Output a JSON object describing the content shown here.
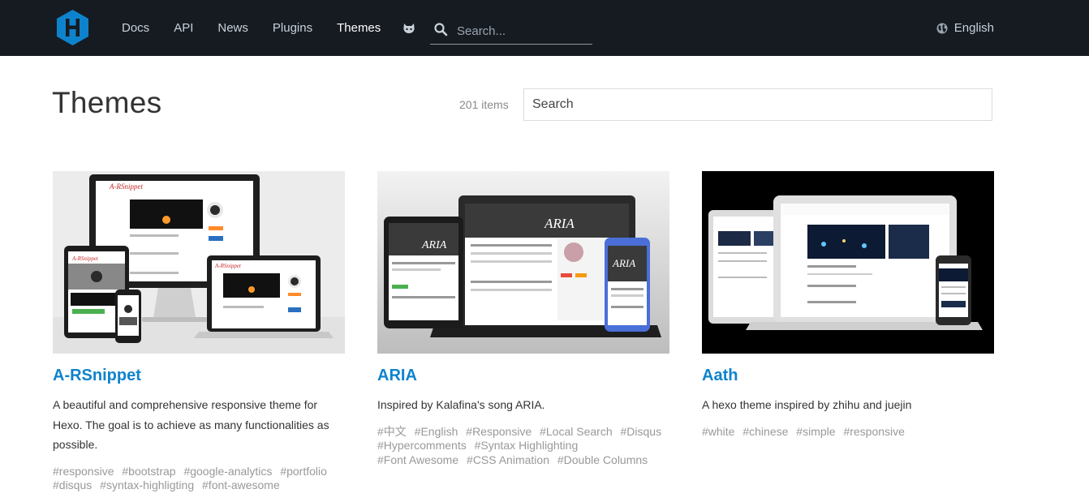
{
  "nav": {
    "items": [
      "Docs",
      "API",
      "News",
      "Plugins",
      "Themes"
    ],
    "search_placeholder": "Search...",
    "language": "English"
  },
  "page": {
    "title": "Themes",
    "count": "201 items",
    "search_placeholder": "Search"
  },
  "themes": [
    {
      "name": "A-RSnippet",
      "description": "A beautiful and comprehensive responsive theme for Hexo. The goal is to achieve as many functionalities as possible.",
      "tags": [
        "#responsive",
        "#bootstrap",
        "#google-analytics",
        "#portfolio",
        "#disqus",
        "#syntax-highligting",
        "#font-awesome"
      ],
      "screen_title": "A-RSnippet"
    },
    {
      "name": "ARIA",
      "description": "Inspired by Kalafina's song ARIA.",
      "tags": [
        "#中文",
        "#English",
        "#Responsive",
        "#Local Search",
        "#Disqus",
        "#Hypercomments",
        "#Syntax Highlighting",
        "#Font Awesome",
        "#CSS Animation",
        "#Double Columns"
      ],
      "screen_title": "ARIA"
    },
    {
      "name": "Aath",
      "description": "A hexo theme inspired by zhihu and juejin",
      "tags": [
        "#white",
        "#chinese",
        "#simple",
        "#responsive"
      ]
    }
  ],
  "colors": {
    "header_bg": "#161b22",
    "link": "#0e83cd",
    "tag": "#999999",
    "logo": "#0e83cd"
  }
}
